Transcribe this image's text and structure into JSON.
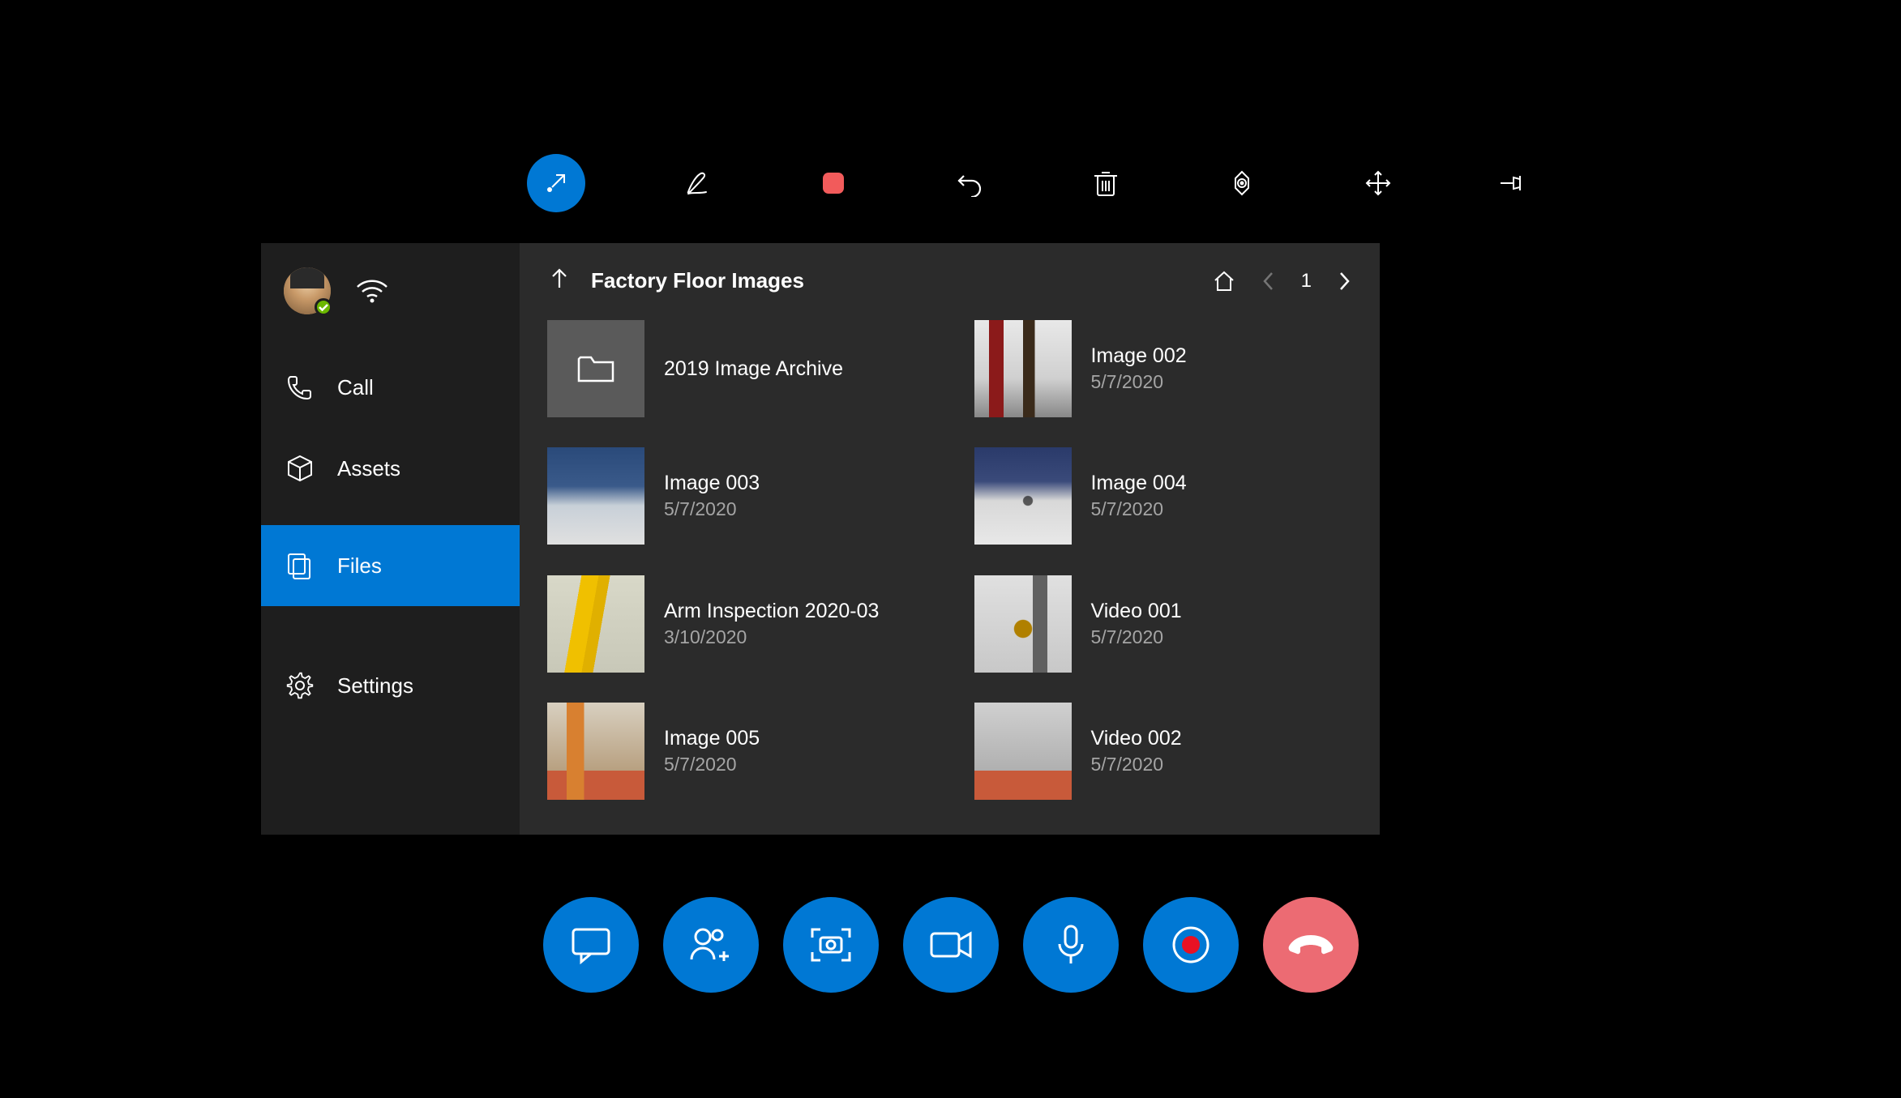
{
  "toolbar": {
    "items": [
      "arrow-in",
      "pen",
      "stop",
      "undo",
      "delete",
      "target",
      "move",
      "pin"
    ]
  },
  "sidebar": {
    "items": [
      {
        "label": "Call"
      },
      {
        "label": "Assets"
      },
      {
        "label": "Files"
      },
      {
        "label": "Settings"
      }
    ]
  },
  "content": {
    "breadcrumb": "Factory Floor Images",
    "page": "1",
    "files": [
      {
        "name": "2019 Image Archive",
        "date": "",
        "type": "folder"
      },
      {
        "name": "Image 002",
        "date": "5/7/2020",
        "type": "image"
      },
      {
        "name": "Image 003",
        "date": "5/7/2020",
        "type": "image"
      },
      {
        "name": "Image 004",
        "date": "5/7/2020",
        "type": "image"
      },
      {
        "name": "Arm Inspection 2020-03",
        "date": "3/10/2020",
        "type": "image"
      },
      {
        "name": "Video 001",
        "date": "5/7/2020",
        "type": "video"
      },
      {
        "name": "Image 005",
        "date": "5/7/2020",
        "type": "image"
      },
      {
        "name": "Video 002",
        "date": "5/7/2020",
        "type": "video"
      }
    ]
  },
  "bottombar": {
    "items": [
      "chat",
      "add-participants",
      "screenshot",
      "video",
      "mic",
      "record",
      "end-call"
    ]
  },
  "colors": {
    "accent": "#0078d4",
    "endcall": "#ec6b73",
    "record_inner": "#e81123"
  }
}
